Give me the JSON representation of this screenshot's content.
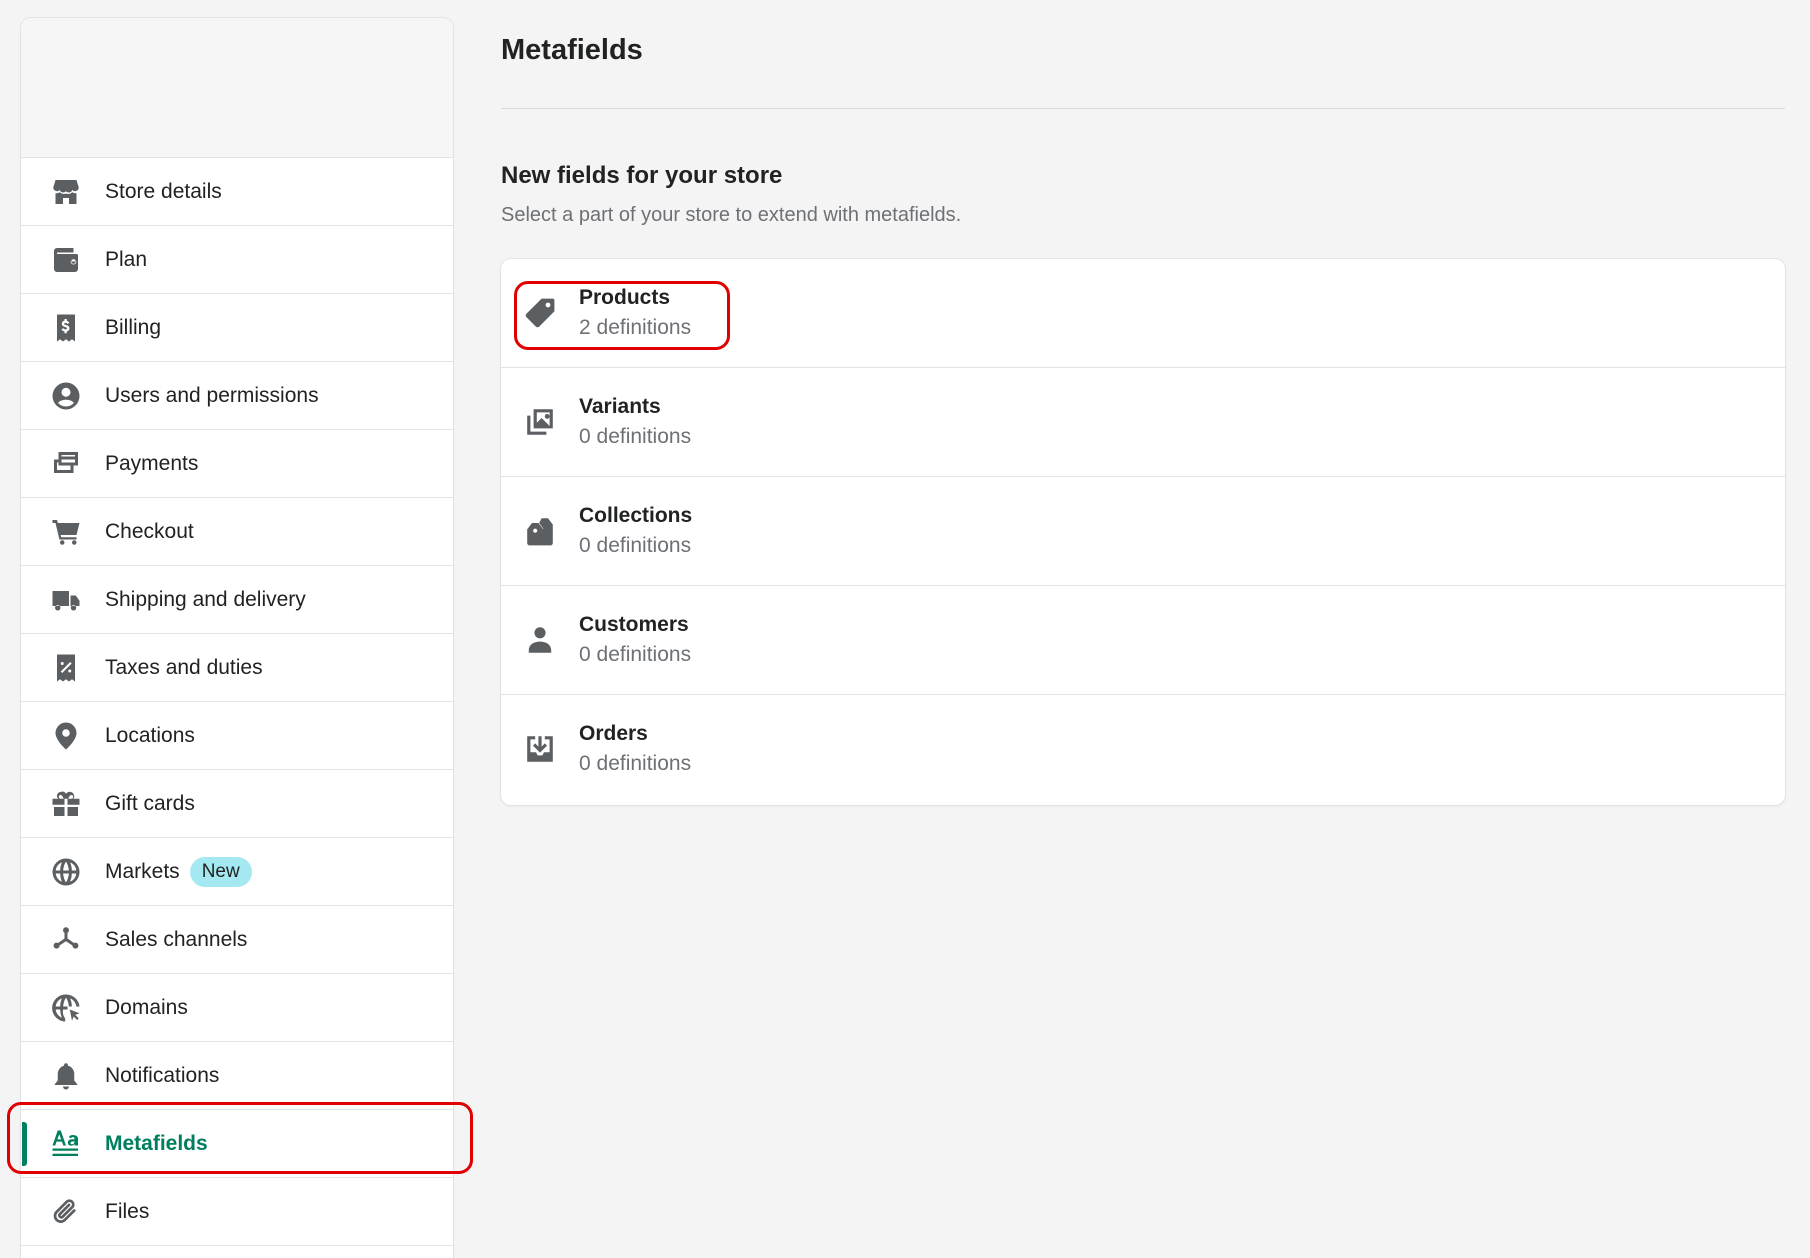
{
  "sidebar": {
    "items": [
      {
        "label": "Store details",
        "icon": "store-icon"
      },
      {
        "label": "Plan",
        "icon": "wallet-icon"
      },
      {
        "label": "Billing",
        "icon": "billing-icon"
      },
      {
        "label": "Users and permissions",
        "icon": "user-circle-icon"
      },
      {
        "label": "Payments",
        "icon": "payments-icon"
      },
      {
        "label": "Checkout",
        "icon": "cart-icon"
      },
      {
        "label": "Shipping and delivery",
        "icon": "truck-icon"
      },
      {
        "label": "Taxes and duties",
        "icon": "tax-receipt-icon"
      },
      {
        "label": "Locations",
        "icon": "location-pin-icon"
      },
      {
        "label": "Gift cards",
        "icon": "gift-icon"
      },
      {
        "label": "Markets",
        "icon": "globe-icon",
        "badge": "New"
      },
      {
        "label": "Sales channels",
        "icon": "channels-icon"
      },
      {
        "label": "Domains",
        "icon": "globe-cursor-icon"
      },
      {
        "label": "Notifications",
        "icon": "bell-icon"
      },
      {
        "label": "Metafields",
        "icon": "metafields-icon",
        "active": true
      },
      {
        "label": "Files",
        "icon": "paperclip-icon"
      }
    ]
  },
  "main": {
    "title": "Metafields",
    "section_title": "New fields for your store",
    "section_subtitle": "Select a part of your store to extend with metafields.",
    "resources": [
      {
        "name": "Products",
        "count": "2 definitions",
        "icon": "tag-icon"
      },
      {
        "name": "Variants",
        "count": "0 definitions",
        "icon": "variants-icon"
      },
      {
        "name": "Collections",
        "count": "0 definitions",
        "icon": "collections-icon"
      },
      {
        "name": "Customers",
        "count": "0 definitions",
        "icon": "customer-icon"
      },
      {
        "name": "Orders",
        "count": "0 definitions",
        "icon": "orders-icon"
      }
    ]
  },
  "colors": {
    "accent": "#008060",
    "active_text": "#007f5f",
    "highlight": "#e00000",
    "badge_bg": "#a4e8f2"
  }
}
